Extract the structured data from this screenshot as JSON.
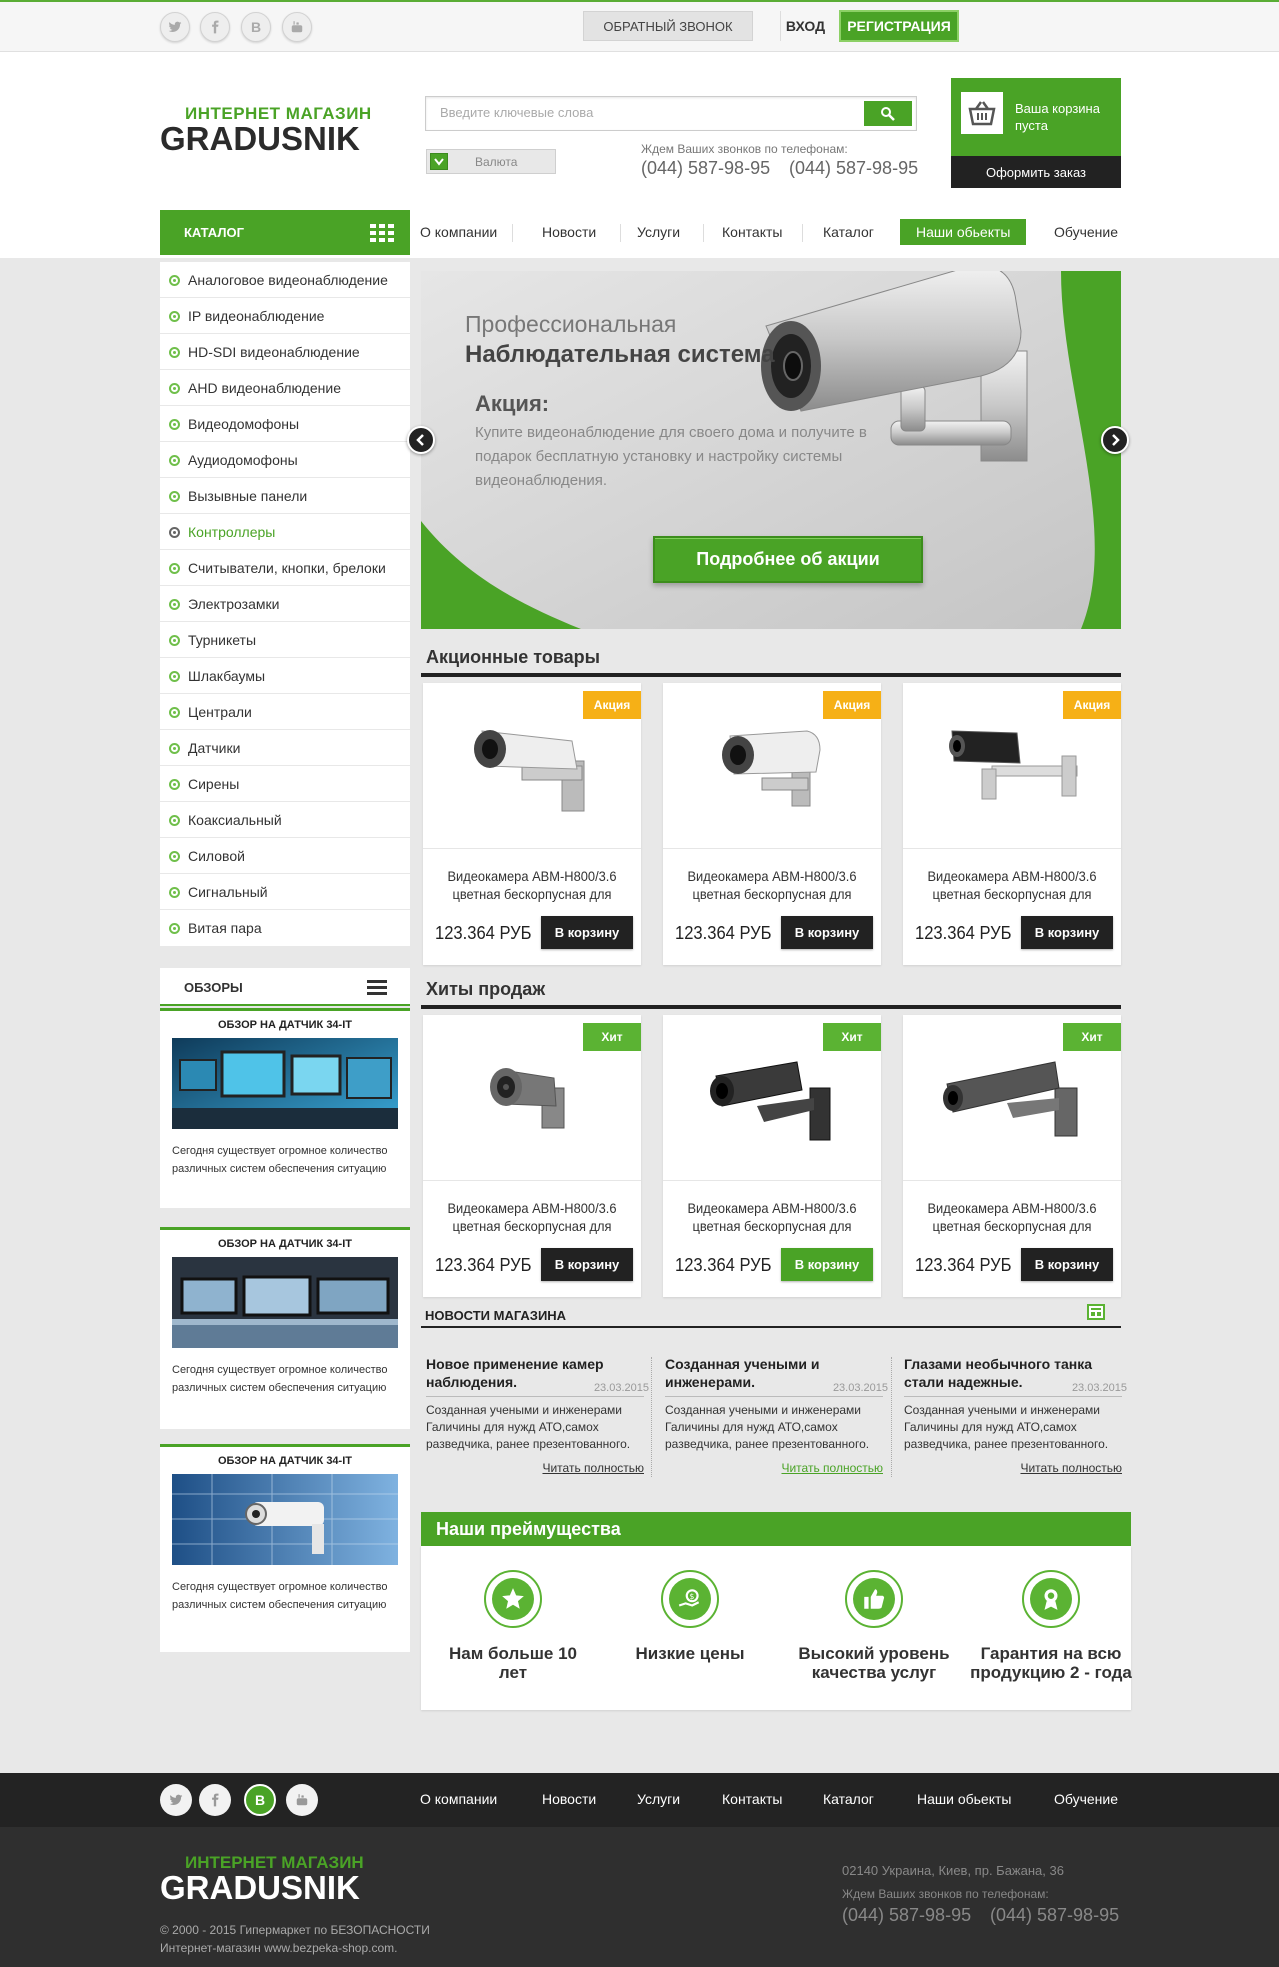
{
  "topbar": {
    "social": [
      "twitter-icon",
      "facebook-icon",
      "vk-icon",
      "youtube-icon"
    ],
    "callback_label": "ОБРАТНЫЙ ЗВОНОК",
    "login_label": "ВХОД",
    "register_label": "РЕГИСТРАЦИЯ"
  },
  "header": {
    "logo_top": "ИНТЕРНЕТ МАГАЗИН",
    "logo_main": "GRADUSNIK",
    "search_placeholder": "Введите ключевые слова",
    "currency_label": "Валюта",
    "phones_caption": "Ждем Ваших звонков по телефонам:",
    "phone1": "(044) 587-98-95",
    "phone2": "(044) 587-98-95",
    "cart_text": "Ваша корзина пуста",
    "cart_button": "Оформить заказ"
  },
  "nav": {
    "catalog_label": "КАТАЛОГ",
    "items": [
      "О компании",
      "Новости",
      "Услуги",
      "Контакты",
      "Каталог",
      "Наши обьекты",
      "Обучение"
    ],
    "active": "Наши обьекты"
  },
  "categories": {
    "items": [
      "Аналоговое видеонаблюдение",
      "IP видеонаблюдение",
      "HD-SDI видеонаблюдение",
      "AHD видеонаблюдение",
      "Видеодомофоны",
      "Аудиодомофоны",
      "Вызывные панели",
      "Контроллеры",
      "Считыватели, кнопки, брелоки",
      "Электрозамки",
      "Турникеты",
      "Шлакбаумы",
      "Централи",
      "Датчики",
      "Сирены",
      "Коаксиальный",
      "Силовой",
      "Сигнальный",
      "Витая пара"
    ],
    "active": "Контроллеры"
  },
  "reviews": {
    "title": "ОБЗОРЫ",
    "items": [
      {
        "title": "ОБЗОР НА ДАТЧИК 34-IT",
        "text": "Сегодня существует огромное количество различных систем обеспечения ситуацию"
      },
      {
        "title": "ОБЗОР НА ДАТЧИК 34-IT",
        "text": "Сегодня существует огромное количество различных систем обеспечения ситуацию"
      },
      {
        "title": "ОБЗОР НА ДАТЧИК 34-IT",
        "text": "Сегодня существует огромное количество различных систем обеспечения ситуацию"
      }
    ]
  },
  "banner": {
    "line1": "Профессиональная",
    "line2": "Наблюдательная система",
    "promo_title": "Акция:",
    "promo_text": "Купите видеонаблюдение для своего дома и получите в подарок бесплатную установку и настройку системы видеонаблюдения.",
    "button": "Подробнее об акции"
  },
  "sale": {
    "title": "Акционные товары",
    "products": [
      {
        "badge": "Акция",
        "name": "Видеокамера ABM-H800/3.6 цветная бескорпусная для",
        "price": "123.364 РУБ",
        "button": "В корзину"
      },
      {
        "badge": "Акция",
        "name": "Видеокамера ABM-H800/3.6 цветная бескорпусная для",
        "price": "123.364 РУБ",
        "button": "В корзину"
      },
      {
        "badge": "Акция",
        "name": "Видеокамера ABM-H800/3.6 цветная бескорпусная для",
        "price": "123.364 РУБ",
        "button": "В корзину"
      }
    ]
  },
  "hits": {
    "title": "Хиты продаж",
    "products": [
      {
        "badge": "Хит",
        "name": "Видеокамера ABM-H800/3.6 цветная бескорпусная для",
        "price": "123.364 РУБ",
        "button": "В корзину"
      },
      {
        "badge": "Хит",
        "name": "Видеокамера ABM-H800/3.6 цветная бескорпусная для",
        "price": "123.364 РУБ",
        "button": "В корзину"
      },
      {
        "badge": "Хит",
        "name": "Видеокамера ABM-H800/3.6 цветная бескорпусная для",
        "price": "123.364 РУБ",
        "button": "В корзину"
      }
    ]
  },
  "news": {
    "title": "НОВОСТИ МАГАЗИНА",
    "items": [
      {
        "title": "Новое применение камер наблюдения.",
        "date": "23.03.2015",
        "text": "Созданная учеными и инженерами Галичины для нужд АТО,самох разведчика, ранее презентованного.",
        "more": "Читать полностью"
      },
      {
        "title": "Созданная учеными и инженерами.",
        "date": "23.03.2015",
        "text": "Созданная учеными и инженерами Галичины для нужд АТО,самох разведчика, ранее презентованного.",
        "more": "Читать полностью"
      },
      {
        "title": "Глазами необычного танка стали надежные.",
        "date": "23.03.2015",
        "text": "Созданная учеными и инженерами Галичины для нужд АТО,самох разведчика, ранее презентованного.",
        "more": "Читать полностью"
      }
    ]
  },
  "advantages": {
    "title": "Наши преймущества",
    "items": [
      {
        "icon": "star-icon",
        "text": "Нам больше 10 лет"
      },
      {
        "icon": "money-icon",
        "text": "Низкие цены"
      },
      {
        "icon": "thumbs-up-icon",
        "text": "Высокий уровень качества  услуг"
      },
      {
        "icon": "award-icon",
        "text": "Гарантия на всю продукцию 2 - года"
      }
    ]
  },
  "footer": {
    "nav": [
      "О компании",
      "Новости",
      "Услуги",
      "Контакты",
      "Каталог",
      "Наши обьекты",
      "Обучение"
    ],
    "logo_top": "ИНТЕРНЕТ МАГАЗИН",
    "logo_main": "GRADUSNIK",
    "copyright1": "© 2000 - 2015 Гипермаркет по БЕЗОПАСНОСТИ",
    "copyright2": "Интернет-магазин www.bezpeka-shop.com.",
    "address": "02140 Украина, Киев, пр. Бажана, 36",
    "phones_caption": "Ждем Ваших звонков по телефонам:",
    "phone1": "(044) 587-98-95",
    "phone2": "(044) 587-98-95"
  },
  "colors": {
    "accent": "#4aa326",
    "badge_sale": "#f6b016",
    "dark": "#222222"
  }
}
